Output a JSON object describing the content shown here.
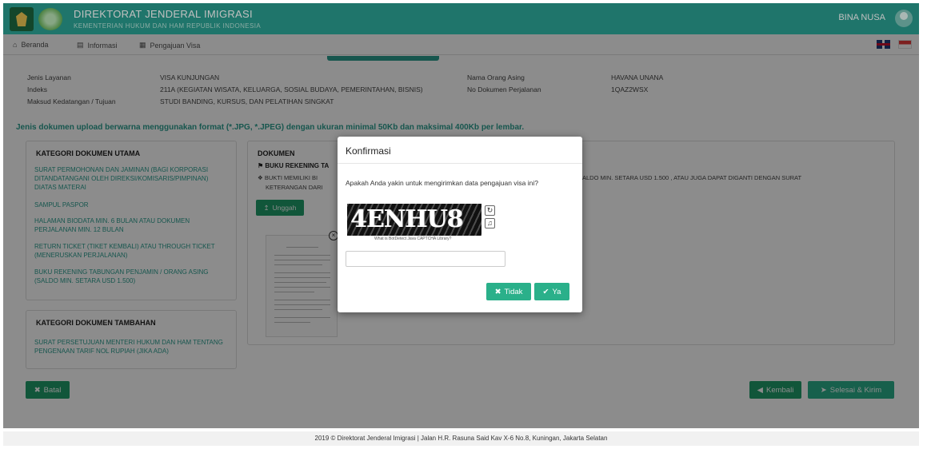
{
  "header": {
    "title": "DIREKTORAT JENDERAL IMIGRASI",
    "subtitle": "KEMENTERIAN HUKUM DAN HAM REPUBLIK INDONESIA",
    "user_name": "BINA NUSA"
  },
  "nav": {
    "items": [
      {
        "icon": "home-icon",
        "label": "Beranda"
      },
      {
        "icon": "book-icon",
        "label": "Informasi"
      },
      {
        "icon": "id-card-icon",
        "label": "Pengajuan Visa"
      }
    ]
  },
  "info": {
    "left": [
      {
        "label": "Jenis Layanan",
        "value": "VISA KUNJUNGAN"
      },
      {
        "label": "Indeks",
        "value": "211A (KEGIATAN WISATA, KELUARGA, SOSIAL BUDAYA, PEMERINTAHAN, BISNIS)"
      },
      {
        "label": "Maksud Kedatangan / Tujuan",
        "value": "STUDI BANDING, KURSUS, DAN PELATIHAN SINGKAT"
      }
    ],
    "right": [
      {
        "label": "Nama Orang Asing",
        "value": "HAVANA UNANA"
      },
      {
        "label": "No Dokumen Perjalanan",
        "value": "1QAZ2WSX"
      }
    ]
  },
  "notice": "Jenis dokumen upload berwarna menggunakan format (*.JPG, *.JPEG) dengan ukuran minimal 50Kb dan maksimal 400Kb per lembar.",
  "kategori_utama": {
    "title": "KATEGORI DOKUMEN UTAMA",
    "items": [
      "SURAT PERMOHONAN DAN JAMINAN (BAGI KORPORASI DITANDATANGANI OLEH DIREKSI/KOMISARIS/PIMPINAN) DIATAS MATERAI",
      "SAMPUL PASPOR",
      "HALAMAN BIODATA MIN. 6 BULAN ATAU DOKUMEN PERJALANAN MIN. 12 BULAN",
      "RETURN TICKET (TIKET KEMBALI) ATAU THROUGH TICKET (MENERUSKAN PERJALANAN)",
      "BUKU REKENING TABUNGAN PENJAMIN / ORANG ASING (SALDO MIN. SETARA USD 1.500)"
    ]
  },
  "kategori_tambahan": {
    "title": "KATEGORI DOKUMEN TAMBAHAN",
    "items": [
      "SURAT PERSETUJUAN MENTERI HUKUM DAN HAM TENTANG PENGENAAN TARIF NOL RUPIAH (JIKA ADA)"
    ]
  },
  "dokumen": {
    "title": "DOKUMEN",
    "heading": "BUKU REKENING TA",
    "desc_left": "BUKTI MEMILIKI BI",
    "desc_left_2": "KETERANGAN DARI",
    "desc_right": "ALDO MIN. SETARA USD 1.500 , ATAU JUGA DAPAT DIGANTI DENGAN SURAT",
    "upload_label": "Unggah"
  },
  "buttons": {
    "batal": "Batal",
    "kembali": "Kembali",
    "selesai": "Selesai & Kirim"
  },
  "footer": "2019 © Direktorat Jenderal Imigrasi | Jalan H.R. Rasuna Said Kav X-6 No.8, Kuningan, Jakarta Selatan",
  "modal": {
    "title": "Konfirmasi",
    "message": "Apakah Anda yakin untuk mengirimkan data pengajuan visa ini?",
    "captcha_text": "4ENHU8",
    "captcha_credit": "What is BotDetect Java CAPTCHA Library?",
    "captcha_input_value": "",
    "tidak_label": "Tidak",
    "ya_label": "Ya"
  },
  "colors": {
    "brand": "#2a9d8f",
    "button": "#2ab08a"
  }
}
